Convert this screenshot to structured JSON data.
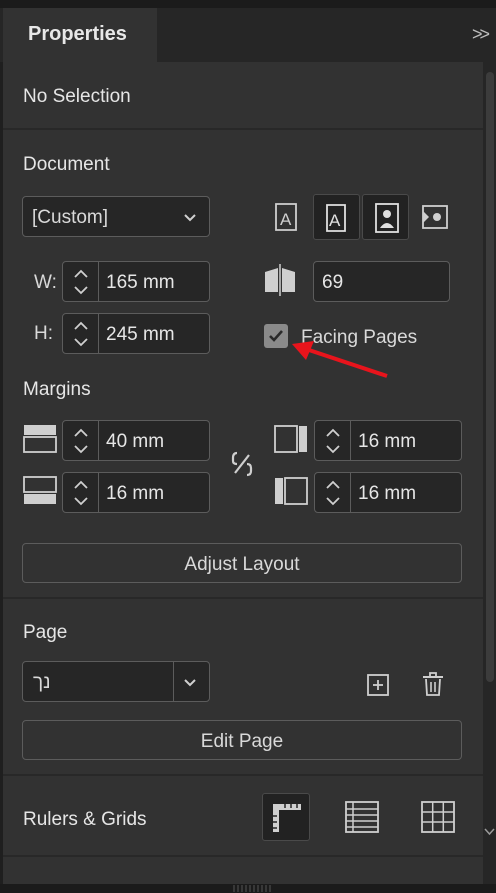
{
  "panel": {
    "tab_title": "Properties",
    "collapse_label": ">>"
  },
  "selection": {
    "label": "No Selection"
  },
  "document": {
    "heading": "Document",
    "preset": "[Custom]",
    "width_label": "W:",
    "width_value": "165 mm",
    "height_label": "H:",
    "height_value": "245 mm",
    "pages_value": "69",
    "facing_pages_label": "Facing Pages",
    "facing_pages_checked": true
  },
  "margins": {
    "heading": "Margins",
    "top": "40 mm",
    "bottom": "16 mm",
    "inside": "16 mm",
    "outside": "16 mm"
  },
  "adjust_layout_label": "Adjust Layout",
  "page": {
    "heading": "Page",
    "selected": "נך",
    "edit_label": "Edit Page"
  },
  "rulers": {
    "heading": "Rulers & Grids"
  },
  "colors": {
    "annotation_arrow": "#e8141c",
    "accent": "#8a8a8a"
  }
}
